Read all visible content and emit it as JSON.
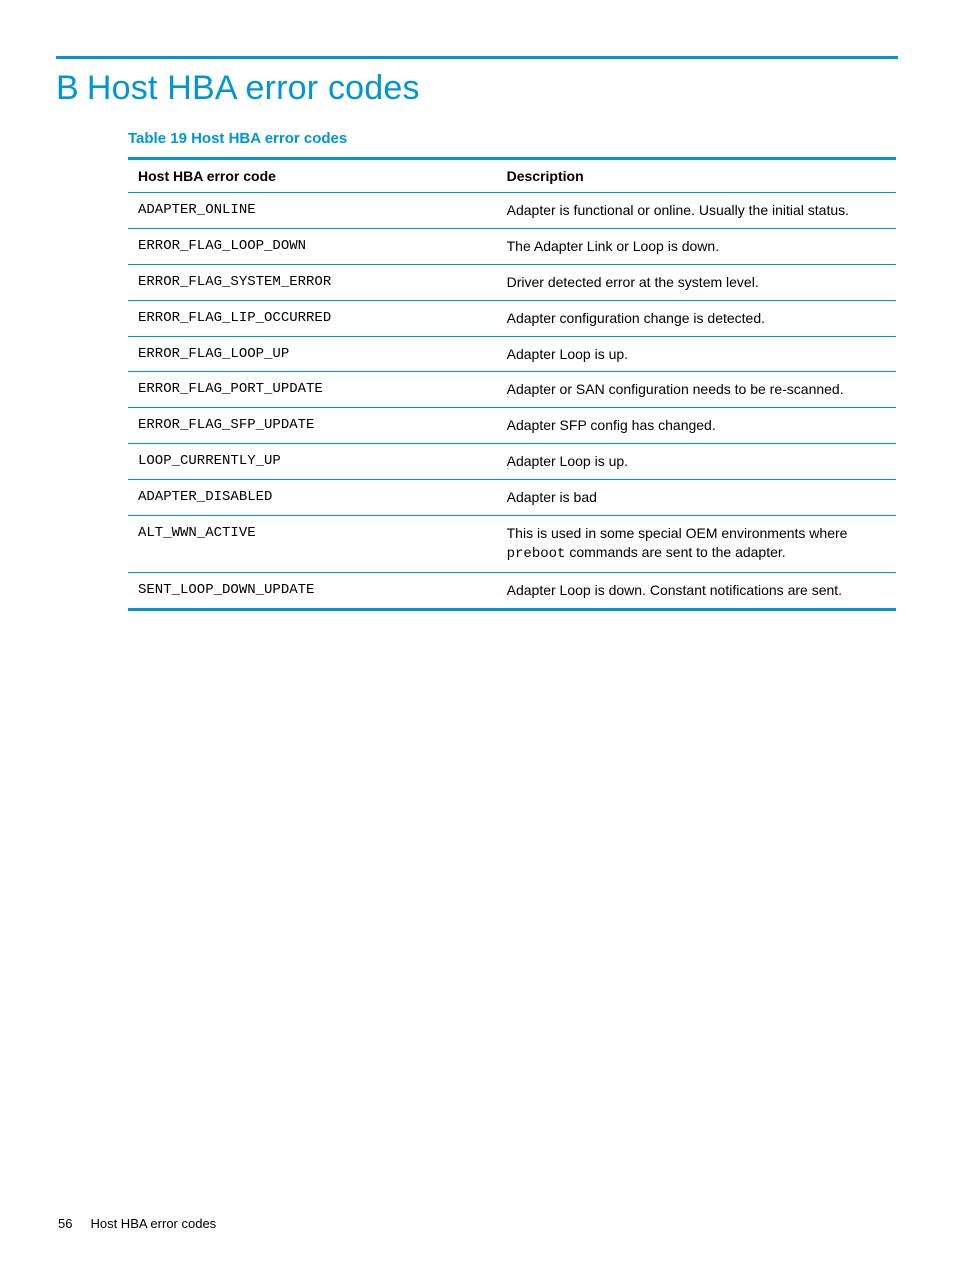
{
  "heading": {
    "letter": "B",
    "text": "Host HBA error codes"
  },
  "table": {
    "caption": "Table 19 Host HBA error codes",
    "headers": {
      "code": "Host HBA error code",
      "desc": "Description"
    },
    "rows": [
      {
        "code": "ADAPTER_ONLINE",
        "desc": "Adapter is functional or online. Usually the initial status."
      },
      {
        "code": "ERROR_FLAG_LOOP_DOWN",
        "desc": "The Adapter Link or Loop is down."
      },
      {
        "code": "ERROR_FLAG_SYSTEM_ERROR",
        "desc": "Driver detected error at the system level."
      },
      {
        "code": "ERROR_FLAG_LIP_OCCURRED",
        "desc": "Adapter configuration change is detected."
      },
      {
        "code": "ERROR_FLAG_LOOP_UP",
        "desc": "Adapter Loop is up."
      },
      {
        "code": "ERROR_FLAG_PORT_UPDATE",
        "desc": "Adapter or SAN configuration needs to be re-scanned."
      },
      {
        "code": "ERROR_FLAG_SFP_UPDATE",
        "desc": "Adapter SFP config has changed."
      },
      {
        "code": "LOOP_CURRENTLY_UP",
        "desc": "Adapter Loop is up."
      },
      {
        "code": "ADAPTER_DISABLED",
        "desc": "Adapter is bad"
      },
      {
        "code": "ALT_WWN_ACTIVE",
        "desc_pre": "This is used in some special OEM environments where ",
        "desc_mono": "preboot",
        "desc_post": " commands are sent to the adapter."
      },
      {
        "code": "SENT_LOOP_DOWN_UPDATE",
        "desc": "Adapter Loop is down. Constant notifications are sent."
      }
    ]
  },
  "footer": {
    "page_number": "56",
    "section": "Host HBA error codes"
  }
}
